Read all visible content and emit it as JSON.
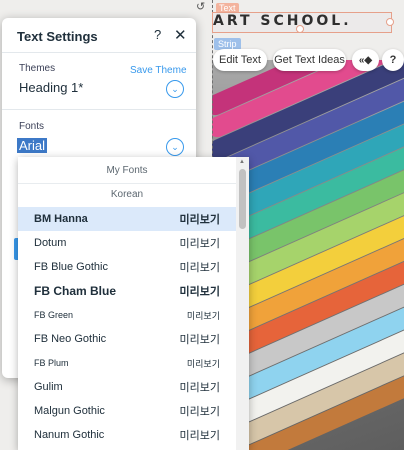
{
  "canvas": {
    "heading_text": "ART SCHOOL.",
    "badge_text": "Text",
    "badge_strip": "Strip",
    "rotate_icon": "↺"
  },
  "toolbar": {
    "edit_text": "Edit Text",
    "get_ideas": "Get Text Ideas",
    "animation_icon": "«◆",
    "help_icon": "?"
  },
  "panel": {
    "title": "Text Settings",
    "help": "?",
    "close": "✕",
    "themes_label": "Themes",
    "save_theme": "Save Theme",
    "themes_value": "Heading 1*",
    "fonts_label": "Fonts",
    "fonts_value": "Arial",
    "chevron": "⌄"
  },
  "dropdown": {
    "groups": [
      "My Fonts",
      "Korean"
    ],
    "items": [
      {
        "name": "BM Hanna",
        "preview": "미리보기",
        "selected": true
      },
      {
        "name": "Dotum",
        "preview": "미리보기"
      },
      {
        "name": "FB Blue Gothic",
        "preview": "미리보기"
      },
      {
        "name": "FB Cham Blue",
        "preview": "미리보기"
      },
      {
        "name": "FB Green",
        "preview": "미리보기"
      },
      {
        "name": "FB Neo Gothic",
        "preview": "미리보기"
      },
      {
        "name": "FB Plum",
        "preview": "미리보기"
      },
      {
        "name": "Gulim",
        "preview": "미리보기"
      },
      {
        "name": "Malgun Gothic",
        "preview": "미리보기"
      },
      {
        "name": "Nanum Gothic",
        "preview": "미리보기"
      }
    ]
  },
  "colors": {
    "accent": "#3899ec",
    "selection": "#3d79c7",
    "selected_row": "#dbe9fa"
  }
}
